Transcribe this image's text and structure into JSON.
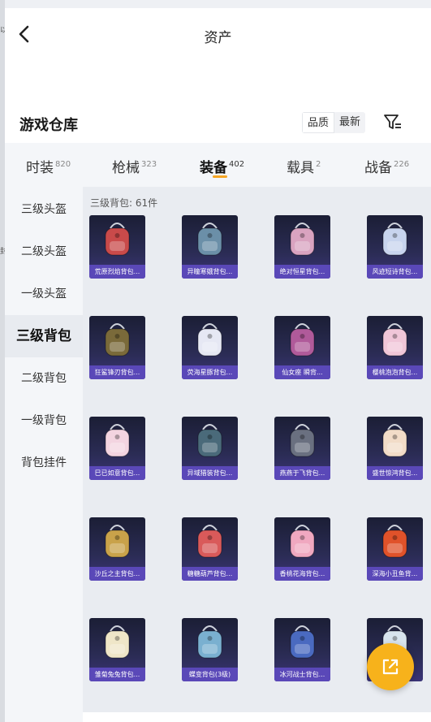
{
  "header": {
    "title": "资产",
    "back_icon": "chevron-left-icon"
  },
  "section": {
    "title": "游戏仓库"
  },
  "sort": {
    "options": [
      "品质",
      "最新"
    ],
    "active": "品质"
  },
  "filter": {
    "icon": "filter-icon"
  },
  "tabs": [
    {
      "label": "时装",
      "count": "820"
    },
    {
      "label": "枪械",
      "count": "323"
    },
    {
      "label": "装备",
      "count": "402",
      "active": true
    },
    {
      "label": "载具",
      "count": "2"
    },
    {
      "label": "战备",
      "count": "226"
    }
  ],
  "sidebar": {
    "items": [
      "三级头盔",
      "二级头盔",
      "一级头盔",
      "三级背包",
      "二级背包",
      "一级背包",
      "背包挂件"
    ],
    "active": "三级背包"
  },
  "content": {
    "header": "三级背包: 61件"
  },
  "items": [
    {
      "label": "荒原烈焰背包...",
      "icon": "backpack-icon",
      "color": "#c94a4a"
    },
    {
      "label": "异瞳寒娥背包...",
      "icon": "backpack-icon",
      "color": "#6b8fa8"
    },
    {
      "label": "绝对恒星背包...",
      "icon": "backpack-icon",
      "color": "#d9a3c0"
    },
    {
      "label": "风迹短诗背包...",
      "icon": "backpack-icon",
      "color": "#c8d4ee"
    },
    {
      "label": "狂鲨锋刃背包...",
      "icon": "backpack-icon",
      "color": "#7a6a3a"
    },
    {
      "label": "荧海星豚背包...",
      "icon": "backpack-icon",
      "color": "#e6e8f4"
    },
    {
      "label": "仙女座 瞬背...",
      "icon": "backpack-icon",
      "color": "#b05a9a"
    },
    {
      "label": "樱桃泡泡背包...",
      "icon": "backpack-icon",
      "color": "#f0c6d8"
    },
    {
      "label": "巳已如意背包...",
      "icon": "backpack-icon",
      "color": "#f3d4e0"
    },
    {
      "label": "异域猎装背包...",
      "icon": "backpack-icon",
      "color": "#4a6a7a"
    },
    {
      "label": "燕燕于飞背包...",
      "icon": "backpack-icon",
      "color": "#6a7080"
    },
    {
      "label": "盛世惊鸿背包...",
      "icon": "backpack-icon",
      "color": "#f2dcc8"
    },
    {
      "label": "沙丘之主背包...",
      "icon": "backpack-icon",
      "color": "#c9a24a"
    },
    {
      "label": "糖糖葫芦背包...",
      "icon": "backpack-icon",
      "color": "#d95a5a"
    },
    {
      "label": "香桃花海背包...",
      "icon": "backpack-icon",
      "color": "#f0a8c0"
    },
    {
      "label": "深海小丑鱼背...",
      "icon": "backpack-icon",
      "color": "#e0522a"
    },
    {
      "label": "雏菊兔兔背包...",
      "icon": "backpack-icon",
      "color": "#efe6c8"
    },
    {
      "label": "蝶变背包(3级)",
      "icon": "backpack-icon",
      "color": "#7ab0d0"
    },
    {
      "label": "冰河战士背包...",
      "icon": "backpack-icon",
      "color": "#4a6ac0"
    },
    {
      "label": "",
      "icon": "backpack-icon",
      "color": "#d8e4ee"
    }
  ],
  "fab": {
    "icon": "external-link-icon",
    "color": "#f7b21b"
  },
  "left_edge_fragments": [
    "以",
    "封"
  ]
}
